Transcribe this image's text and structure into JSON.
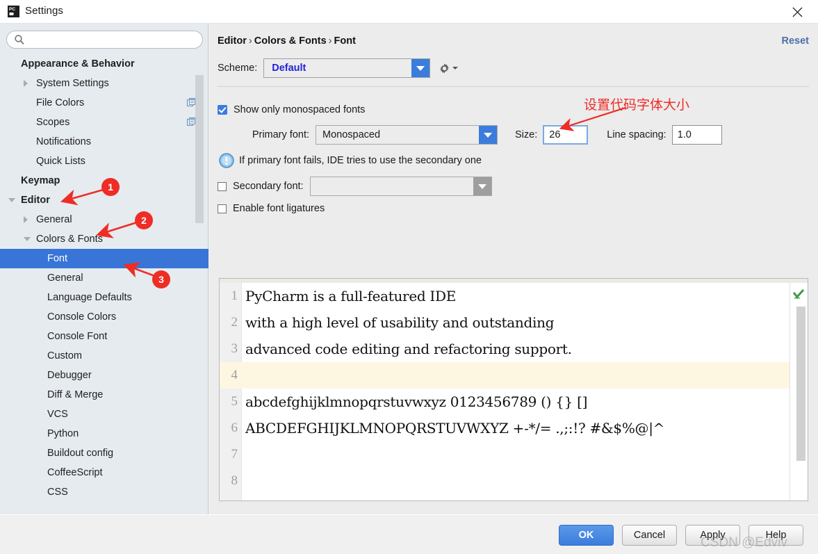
{
  "window": {
    "title": "Settings",
    "app_icon": "pycharm-icon",
    "close_icon": "close-icon"
  },
  "sidebar": {
    "search": {
      "value": "",
      "placeholder": "",
      "icon": "search-icon"
    },
    "items": [
      {
        "label": "Appearance & Behavior",
        "indent": 0,
        "bold": true,
        "twisty": "none",
        "copy": false,
        "selected": false
      },
      {
        "label": "System Settings",
        "indent": 1,
        "bold": false,
        "twisty": "closed",
        "copy": false,
        "selected": false
      },
      {
        "label": "File Colors",
        "indent": 1,
        "bold": false,
        "twisty": "none",
        "copy": true,
        "selected": false
      },
      {
        "label": "Scopes",
        "indent": 1,
        "bold": false,
        "twisty": "none",
        "copy": true,
        "selected": false
      },
      {
        "label": "Notifications",
        "indent": 1,
        "bold": false,
        "twisty": "none",
        "copy": false,
        "selected": false
      },
      {
        "label": "Quick Lists",
        "indent": 1,
        "bold": false,
        "twisty": "none",
        "copy": false,
        "selected": false
      },
      {
        "label": "Keymap",
        "indent": 0,
        "bold": true,
        "twisty": "none",
        "copy": false,
        "selected": false
      },
      {
        "label": "Editor",
        "indent": 0,
        "bold": true,
        "twisty": "open",
        "copy": false,
        "selected": false
      },
      {
        "label": "General",
        "indent": 1,
        "bold": false,
        "twisty": "closed",
        "copy": false,
        "selected": false
      },
      {
        "label": "Colors & Fonts",
        "indent": 1,
        "bold": false,
        "twisty": "open",
        "copy": false,
        "selected": false
      },
      {
        "label": "Font",
        "indent": 2,
        "bold": false,
        "twisty": "none",
        "copy": false,
        "selected": true
      },
      {
        "label": "General",
        "indent": 2,
        "bold": false,
        "twisty": "none",
        "copy": false,
        "selected": false
      },
      {
        "label": "Language Defaults",
        "indent": 2,
        "bold": false,
        "twisty": "none",
        "copy": false,
        "selected": false
      },
      {
        "label": "Console Colors",
        "indent": 2,
        "bold": false,
        "twisty": "none",
        "copy": false,
        "selected": false
      },
      {
        "label": "Console Font",
        "indent": 2,
        "bold": false,
        "twisty": "none",
        "copy": false,
        "selected": false
      },
      {
        "label": "Custom",
        "indent": 2,
        "bold": false,
        "twisty": "none",
        "copy": false,
        "selected": false
      },
      {
        "label": "Debugger",
        "indent": 2,
        "bold": false,
        "twisty": "none",
        "copy": false,
        "selected": false
      },
      {
        "label": "Diff & Merge",
        "indent": 2,
        "bold": false,
        "twisty": "none",
        "copy": false,
        "selected": false
      },
      {
        "label": "VCS",
        "indent": 2,
        "bold": false,
        "twisty": "none",
        "copy": false,
        "selected": false
      },
      {
        "label": "Python",
        "indent": 2,
        "bold": false,
        "twisty": "none",
        "copy": false,
        "selected": false
      },
      {
        "label": "Buildout config",
        "indent": 2,
        "bold": false,
        "twisty": "none",
        "copy": false,
        "selected": false
      },
      {
        "label": "CoffeeScript",
        "indent": 2,
        "bold": false,
        "twisty": "none",
        "copy": false,
        "selected": false
      },
      {
        "label": "CSS",
        "indent": 2,
        "bold": false,
        "twisty": "none",
        "copy": false,
        "selected": false
      }
    ]
  },
  "content": {
    "breadcrumb": {
      "part1": "Editor",
      "part2": "Colors & Fonts",
      "part3": "Font",
      "separator": "›"
    },
    "reset_label": "Reset",
    "scheme": {
      "label": "Scheme:",
      "value": "Default",
      "gear_icon": "gear-icon",
      "arrow_icon": "chevron-down-icon"
    },
    "options": {
      "show_monospaced": {
        "label": "Show only monospaced fonts",
        "checked": true
      },
      "primary_font": {
        "label": "Primary font:",
        "value": "Monospaced"
      },
      "size": {
        "label": "Size:",
        "value": "26"
      },
      "line_spacing": {
        "label": "Line spacing:",
        "value": "1.0"
      },
      "hint": {
        "text": "If primary font fails, IDE tries to use the secondary one",
        "icon": "info-icon"
      },
      "secondary_font": {
        "label": "Secondary font:",
        "value": "",
        "checked": false
      },
      "ligatures": {
        "label": "Enable font ligatures",
        "checked": false
      }
    }
  },
  "preview": {
    "check_icon": "green-check-icon",
    "highlight_line": 4,
    "lines": [
      {
        "no": "1",
        "text": "PyCharm is a full-featured IDE"
      },
      {
        "no": "2",
        "text": "with a high level of usability and outstanding"
      },
      {
        "no": "3",
        "text": "advanced code editing and refactoring support."
      },
      {
        "no": "4",
        "text": ""
      },
      {
        "no": "5",
        "text": "abcdefghijklmnopqrstuvwxyz 0123456789 () {} []"
      },
      {
        "no": "6",
        "text": "ABCDEFGHIJKLMNOPQRSTUVWXYZ +-*/= .,;:!? #&$%@|^"
      },
      {
        "no": "7",
        "text": ""
      },
      {
        "no": "8",
        "text": ""
      }
    ]
  },
  "buttons": {
    "ok": "OK",
    "cancel": "Cancel",
    "apply": "Apply",
    "help": "Help"
  },
  "annotations": {
    "badge1": "1",
    "badge2": "2",
    "badge3": "3",
    "note": "设置代码字体大小",
    "watermark": "CSDN @Edviv",
    "color": "#ee2d26"
  }
}
